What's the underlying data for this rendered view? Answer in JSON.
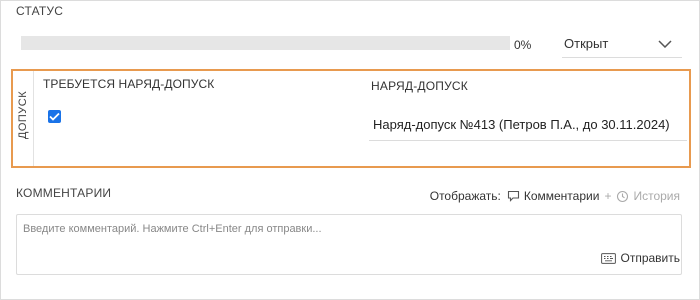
{
  "status": {
    "heading": "СТАТУС",
    "progress": 0,
    "progress_label": "0%",
    "select_value": "Открыт"
  },
  "permit": {
    "vertical_label": "ДОПУСК",
    "required_label": "ТРЕБУЕТСЯ НАРЯД-ДОПУСК",
    "required_checked": true,
    "permit_label": "НАРЯД-ДОПУСК",
    "permit_value": "Наряд-допуск №413 (Петров П.А., до 30.11.2024)",
    "accent_color": "#e89a4f"
  },
  "comments": {
    "heading": "КОММЕНТАРИИ",
    "display_label": "Отображать:",
    "toggle_comments": "Комментарии",
    "separator": "+",
    "toggle_history": "История",
    "placeholder": "Введите комментарий. Нажмите Ctrl+Enter для отправки...",
    "send_label": "Отправить"
  },
  "icons": {
    "chevron": "chevron-down-icon",
    "checkbox": "check-icon",
    "comment": "comment-icon",
    "history": "history-icon",
    "send": "keyboard-icon"
  }
}
